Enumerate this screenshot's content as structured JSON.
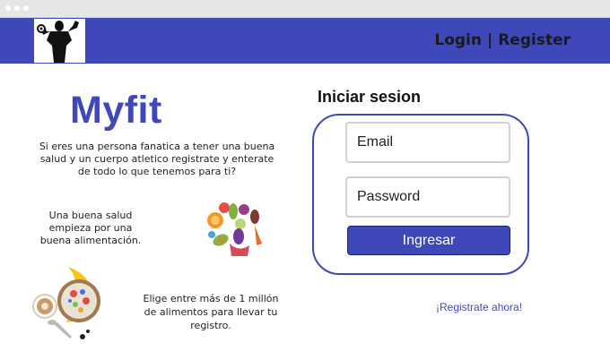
{
  "nav": {
    "login": "Login",
    "separator": "|",
    "register": "Register"
  },
  "brand": {
    "name": "Myfit"
  },
  "intro": {
    "text": "Si eres una persona fanatica a tener una buena salud y un cuerpo atletico registrate y enterate de todo lo que tenemos para ti?"
  },
  "tips": {
    "tip1": "Una buena salud empieza por una buena alimentación.",
    "tip2": "Elige entre más de 1 millón de alimentos para llevar tu registro."
  },
  "login": {
    "title": "Iniciar sesion",
    "email_placeholder": "Email",
    "password_placeholder": "Password",
    "submit": "Ingresar",
    "register_link": "¡Registrate ahora!"
  },
  "colors": {
    "brand": "#3f48b8",
    "header": "#3f48b8",
    "field_border": "#d2d2d2"
  },
  "icons": {
    "logo": "bodybuilder-logo-icon",
    "food1": "vegetables-icon",
    "food2": "fruit-bowl-icon"
  }
}
